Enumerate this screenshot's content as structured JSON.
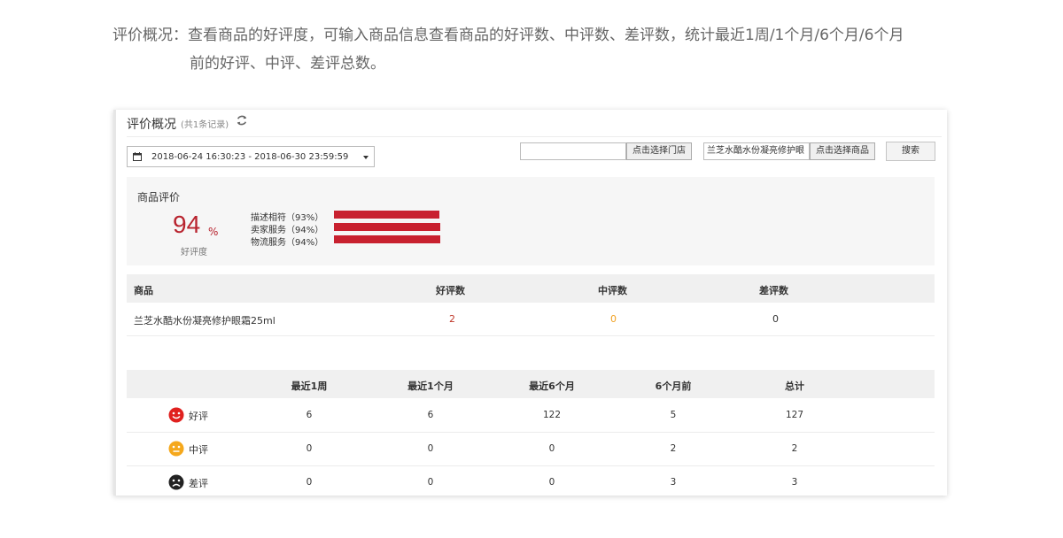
{
  "intro": {
    "label": "评价概况：",
    "line1": "查看商品的好评度，可输入商品信息查看商品的好评数、中评数、差评数，统计最近1周/1个月/6个月/6个月",
    "line2": "前的好评、中评、差评总数。"
  },
  "panel": {
    "title": "评价概况",
    "count": "(共1条记录)",
    "date_range": "2018-06-24 16:30:23 - 2018-06-30 23:59:59",
    "store_input_value": "",
    "store_button": "点击选择门店",
    "product_input_value": "兰芝水酷水份凝亮修护眼",
    "product_button": "点击选择商品",
    "search_button": "搜索"
  },
  "rating": {
    "title": "商品评价",
    "percent": "94",
    "percent_sign": "%",
    "percent_label": "好评度",
    "items": [
      {
        "label": "描述相符（93%）",
        "value": 93
      },
      {
        "label": "卖家服务（94%）",
        "value": 94
      },
      {
        "label": "物流服务（94%）",
        "value": 94
      }
    ],
    "bar_color": "#c8212f"
  },
  "product_table": {
    "headers": [
      "商品",
      "好评数",
      "中评数",
      "差评数"
    ],
    "rows": [
      {
        "name": "兰芝水酷水份凝亮修护眼霜25ml",
        "good": "2",
        "mid": "0",
        "bad": "0"
      }
    ]
  },
  "stats_table": {
    "headers": [
      "最近1周",
      "最近1个月",
      "最近6个月",
      "6个月前",
      "总计"
    ],
    "rows": [
      {
        "type": "好评",
        "icon": "happy-face-icon",
        "color": "#e0211f",
        "values": [
          "6",
          "6",
          "122",
          "5",
          "127"
        ]
      },
      {
        "type": "中评",
        "icon": "neutral-face-icon",
        "color": "#f5a81c",
        "values": [
          "0",
          "0",
          "0",
          "2",
          "2"
        ]
      },
      {
        "type": "差评",
        "icon": "sad-face-icon",
        "color": "#222222",
        "values": [
          "0",
          "0",
          "0",
          "3",
          "3"
        ]
      }
    ]
  }
}
